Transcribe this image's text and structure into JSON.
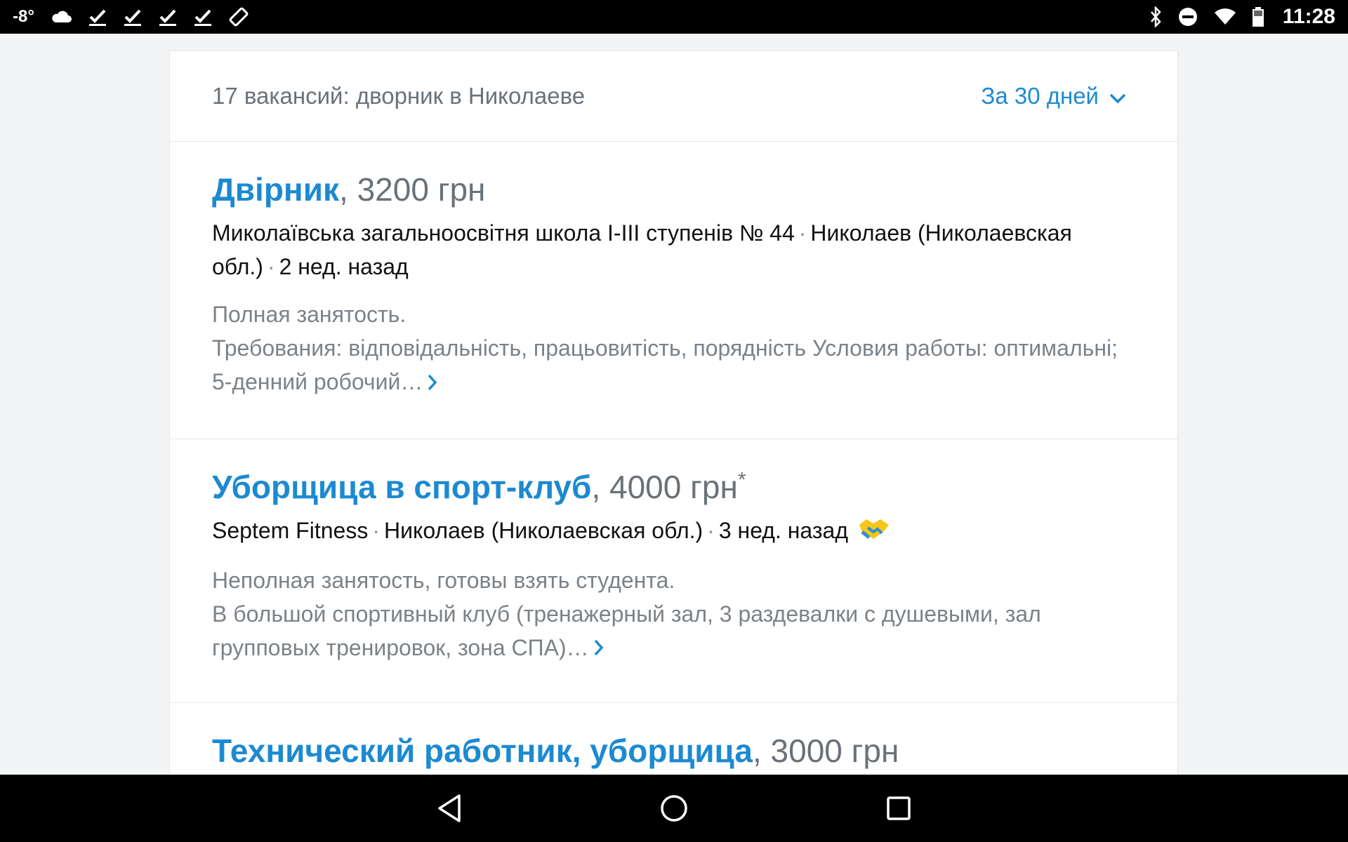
{
  "status_bar": {
    "temperature": "-8°",
    "time": "11:28",
    "icons": [
      "cloud-icon",
      "check-icon",
      "check-icon",
      "check-icon",
      "check-icon",
      "screen-rotation-icon",
      "bluetooth-icon",
      "do-not-disturb-icon",
      "wifi-icon",
      "battery-icon"
    ]
  },
  "results_header": {
    "count_text": "17 вакансий: дворник в Николаеве",
    "period_label": "За 30 дней"
  },
  "vacancies": [
    {
      "title": "Двірник",
      "salary": ", 3200 грн",
      "company": "Миколаївська загальноосвітня школа І-ІІІ ступенів № 44",
      "location": "Николаев (Николаевская обл.)",
      "posted": "2 нед. назад",
      "employment": "Полная занятость.",
      "snippet": "Требования: відповідальність, працьовитість, порядність Условия работы: оптимальні; 5-денний робочий…"
    },
    {
      "title": "Уборщица в спорт-клуб",
      "salary": ", 4000 грн",
      "salary_mark": "*",
      "company": "Septem Fitness",
      "location": "Николаев (Николаевская обл.)",
      "posted": "3 нед. назад",
      "employment": "Неполная занятость, готовы взять студента.",
      "snippet": "В большой спортивный клуб (тренажерный зал, 3 раздевалки с душевыми, зал групповых тренировок, зона СПА)…"
    },
    {
      "title": "Технический работник, уборщица",
      "salary": ", 3000 грн"
    }
  ],
  "colors": {
    "accent": "#1c8ad1",
    "muted_text": "#7b8288",
    "background": "#f3f4f6"
  }
}
